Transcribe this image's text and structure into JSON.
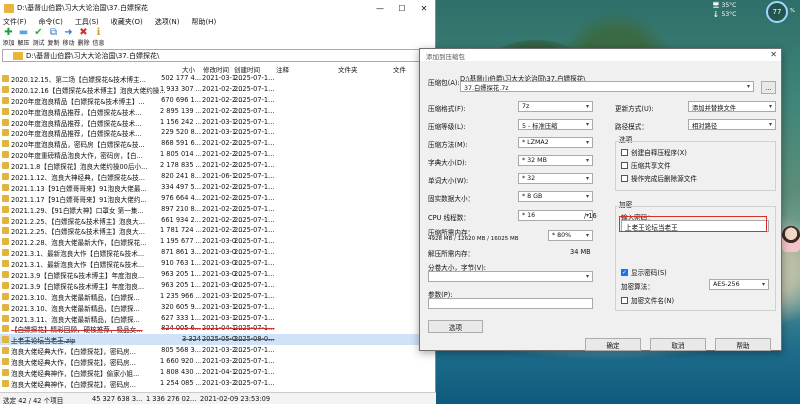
{
  "hud": {
    "line1": "🖥 35°C",
    "line2": "🌡 53°C",
    "percent": "77",
    "unit": "%"
  },
  "file_manager": {
    "title": "D:\\基督山伯爵\\习大大论治国\\37.白嫖探花",
    "window_controls": [
      "—",
      "☐",
      "✕"
    ],
    "menu": [
      "文件(F)",
      "命令(C)",
      "工具(S)",
      "收藏夹(O)",
      "选项(N)",
      "帮助(H)"
    ],
    "toolbar": [
      {
        "label": "添加",
        "icon": "add-icon",
        "glyph": "✚",
        "color": "#1aa130"
      },
      {
        "label": "解压",
        "icon": "extract-icon",
        "glyph": "▬",
        "color": "#5aa6e0"
      },
      {
        "label": "测试",
        "icon": "test-icon",
        "glyph": "✔",
        "color": "#3aaa3a"
      },
      {
        "label": "复制",
        "icon": "copy-icon",
        "glyph": "⧉",
        "color": "#3478c6"
      },
      {
        "label": "移动",
        "icon": "move-icon",
        "glyph": "➜",
        "color": "#2b7bd6"
      },
      {
        "label": "删除",
        "icon": "delete-icon",
        "glyph": "✖",
        "color": "#d62e2e"
      },
      {
        "label": "信息",
        "icon": "info-icon",
        "glyph": "ℹ",
        "color": "#c9a227"
      }
    ],
    "path": "D:\\基督山伯爵\\习大大论治国\\37.白嫖探花\\",
    "columns": [
      "名称",
      "大小",
      "修改时间",
      "创建时间",
      "注释",
      "文件夹",
      "文件"
    ],
    "rows": [
      {
        "name": "2020.12.15、第二场【白嫖探花&技术博主...",
        "size": "502 177 4...",
        "mod": "2021-03-1...",
        "cre": "2025-07-1..."
      },
      {
        "name": "2020.12.16【白嫖探花&技术博主】泡良大佬约操...",
        "size": "1 933 307 ...",
        "mod": "2021-02-2...",
        "cre": "2025-07-1..."
      },
      {
        "name": "2020年度泡良精品【白嫖探花&技术博主】...",
        "size": "670 696 1...",
        "mod": "2021-02-2...",
        "cre": "2025-07-1..."
      },
      {
        "name": "2020年度泡良精品推荐，【白嫖探花&技术...",
        "size": "2 895 139 ...",
        "mod": "2021-02-2...",
        "cre": "2025-07-1..."
      },
      {
        "name": "2020年度泡良精品推荐，【白嫖探花&技术...",
        "size": "1 156 242 ...",
        "mod": "2021-03-1...",
        "cre": "2025-07-1..."
      },
      {
        "name": "2020年度泡良精品推荐，【白嫖探花&技术...",
        "size": "229 520 8...",
        "mod": "2021-03-1...",
        "cre": "2025-07-1..."
      },
      {
        "name": "2020年度泡良精品，密码房【白嫖探花&技...",
        "size": "868 591 6...",
        "mod": "2021-02-2...",
        "cre": "2025-07-1..."
      },
      {
        "name": "2020年度重磅精品泡良大作，密码房，【白...",
        "size": "1 805 014 ...",
        "mod": "2021-02-2...",
        "cre": "2025-07-1..."
      },
      {
        "name": "2021.1.8【白嫖探花】泡良大佬约操00后小...",
        "size": "2 178 835 ...",
        "mod": "2021-02-2...",
        "cre": "2025-07-1..."
      },
      {
        "name": "2021.1.12、泡良大神经典，【白嫖探花&技...",
        "size": "820 241 8...",
        "mod": "2021-06-1...",
        "cre": "2025-07-1..."
      },
      {
        "name": "2021.1.13【91白嫖哥哥来】91泡良大佬最...",
        "size": "334 497 5...",
        "mod": "2021-02-2...",
        "cre": "2025-07-1..."
      },
      {
        "name": "2021.1.17【91白嫖哥哥来】91泡良大佬约...",
        "size": "976 664 4...",
        "mod": "2021-02-2...",
        "cre": "2025-07-1..."
      },
      {
        "name": "2021.1.29、【91白嫖大神】口罩女 第一集...",
        "size": "897 210 8...",
        "mod": "2021-02-2...",
        "cre": "2025-07-1..."
      },
      {
        "name": "2021.2.25、【白嫖探花&技术博主】泡良大...",
        "size": "661 934 2...",
        "mod": "2021-02-2...",
        "cre": "2025-07-1..."
      },
      {
        "name": "2021.2.25、【白嫖探花&技术博主】泡良大...",
        "size": "1 781 724 ...",
        "mod": "2021-02-2...",
        "cre": "2025-07-1..."
      },
      {
        "name": "2021.2.28、泡良大佬最新大作，【白嫖探花...",
        "size": "1 195 677 ...",
        "mod": "2021-03-0...",
        "cre": "2025-07-1..."
      },
      {
        "name": "2021.3.1、最新泡良大作【白嫖探花&技术...",
        "size": "871 861 3...",
        "mod": "2021-03-0...",
        "cre": "2025-07-1..."
      },
      {
        "name": "2021.3.1、最新泡良大作【白嫖探花&技术...",
        "size": "910 763 1...",
        "mod": "2021-03-0...",
        "cre": "2025-07-1..."
      },
      {
        "name": "2021.3.9【白嫖探花&技术博主】年度泡良...",
        "size": "963 205 1...",
        "mod": "2021-03-0...",
        "cre": "2025-07-1..."
      },
      {
        "name": "2021.3.9【白嫖探花&技术博主】年度泡良...",
        "size": "963 205 1...",
        "mod": "2021-03-0...",
        "cre": "2025-07-1..."
      },
      {
        "name": "2021.3.10、泡良大佬最新精品，【白嫖探...",
        "size": "1 235 966 ...",
        "mod": "2021-03-1...",
        "cre": "2025-07-1..."
      },
      {
        "name": "2021.3.10、泡良大佬最新精品，【白嫖探...",
        "size": "320 605 9...",
        "mod": "2021-03-1...",
        "cre": "2025-07-1..."
      },
      {
        "name": "2021.3.11、泡良大佬最新精品，【白嫖探...",
        "size": "627 333 1...",
        "mod": "2021-03-1...",
        "cre": "2025-07-1..."
      },
      {
        "name": "【白嫖探花】精彩回顾，硬核推荐，极品女...",
        "size": "824 005 6...",
        "mod": "2021-04-1...",
        "cre": "2025-07-1..."
      },
      {
        "name": "上老王论坛当老王.zip",
        "size": "3 324",
        "mod": "2025-05-0...",
        "cre": "2025-08-0..."
      },
      {
        "name": "泡良大佬经典大作，【白嫖探花】，密码房...",
        "size": "805 568 3...",
        "mod": "2021-03-2...",
        "cre": "2025-07-1..."
      },
      {
        "name": "泡良大佬经典大作，【白嫖探花】，密码房...",
        "size": "1 660 920 ...",
        "mod": "2021-03-2...",
        "cre": "2025-07-1..."
      },
      {
        "name": "泡良大佬经典神作，【白嫖探花】偷家小姐...",
        "size": "1 808 430 ...",
        "mod": "2021-04-1...",
        "cre": "2025-07-1..."
      },
      {
        "name": "泡良大佬经典神作，【白嫖探花】，密码房...",
        "size": "1 254 085 ...",
        "mod": "2021-03-2...",
        "cre": "2025-07-1..."
      }
    ],
    "status": {
      "selected": "选定 42 / 42 个项目",
      "total": "45 327 638 3...",
      "size2": "1 336 276 02...",
      "date": "2021-02-09 23:53:09"
    }
  },
  "dialog": {
    "title": "添加到压缩包",
    "close": "✕",
    "archive_label": "压缩包(A):",
    "archive_path": "D:\\基督山伯爵\\习大大论治国\\37.白嫖探花\\",
    "archive_name": "37.白嫖探花.7z",
    "browse": "...",
    "format_label": "压缩格式(F):",
    "format_value": "7z",
    "level_label": "压缩等级(L):",
    "level_value": "5 - 标准压缩",
    "method_label": "压缩方法(M):",
    "method_value": "* LZMA2",
    "dict_label": "字典大小(D):",
    "dict_value": "* 32 MB",
    "word_label": "单词大小(W):",
    "word_value": "* 32",
    "solid_label": "固实数据大小：",
    "solid_value": "* 8 GB",
    "threads_label": "CPU 线程数：",
    "threads_value": "* 16",
    "threads_max": "/ 16",
    "mem_label": "压缩所需内存：",
    "mem_detail": "4928 MB / 12620 MB / 16025 MB",
    "mem_value": "* 80%",
    "dmem_label": "解压所需内存：",
    "dmem_value": "34 MB",
    "split_label": "分卷大小，字节(V):",
    "params_label": "参数(P):",
    "options_btn": "选项",
    "update_label": "更新方式(U):",
    "update_value": "添加并替换文件",
    "path_label": "路径模式：",
    "path_value": "相对路径",
    "options_group": "选项",
    "opt_sfx": "创建自释压程序(X)",
    "opt_shared": "压缩共享文件",
    "opt_delete": "操作完成后删除源文件",
    "encrypt_group": "加密",
    "password_label": "输入密码：",
    "password_value": "上老王论坛当老王",
    "show_pw": "显示密码(S)",
    "enc_method_label": "加密算法：",
    "enc_method_value": "AES-256",
    "enc_names": "加密文件名(N)",
    "ok": "确定",
    "cancel": "取消",
    "help": "帮助"
  }
}
